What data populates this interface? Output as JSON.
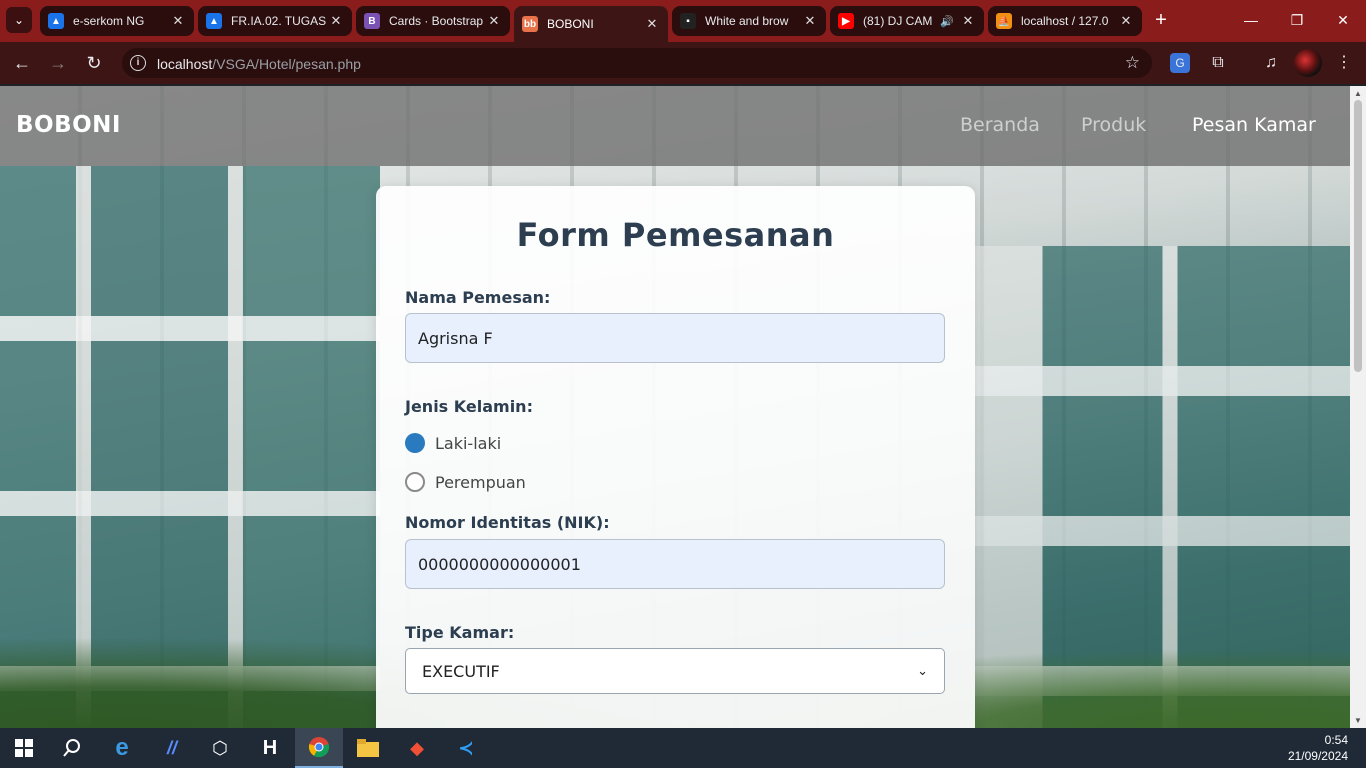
{
  "browser": {
    "tabs": [
      {
        "title": "e-serkom NG",
        "favicon": "triangle-icon",
        "color": "#1a73e8"
      },
      {
        "title": "FR.IA.02. TUGAS",
        "favicon": "triangle-icon",
        "color": "#1a73e8"
      },
      {
        "title": "Cards · Bootstrap",
        "favicon": "B",
        "color": "#7952b3"
      },
      {
        "title": "BOBONI",
        "favicon": "bb-icon",
        "color": "#e8734a"
      },
      {
        "title": "White and brow",
        "favicon": "image-icon",
        "color": "#222"
      },
      {
        "title": "(81) DJ CAM",
        "favicon": "youtube-icon",
        "color": "#ff0000"
      },
      {
        "title": "localhost / 127.0",
        "favicon": "pma-icon",
        "color": "#f29111"
      }
    ],
    "url_host": "localhost",
    "url_path": "/VSGA/Hotel/pesan.php"
  },
  "site": {
    "brand": "BOBONI",
    "nav": [
      "Beranda",
      "Produk",
      "Pesan Kamar"
    ]
  },
  "form": {
    "title": "Form Pemesanan",
    "name_label": "Nama Pemesan:",
    "name_value": "Agrisna F",
    "gender_label": "Jenis Kelamin:",
    "gender_options": [
      "Laki-laki",
      "Perempuan"
    ],
    "gender_selected": "Laki-laki",
    "nik_label": "Nomor Identitas (NIK):",
    "nik_value": "0000000000000001",
    "room_label": "Tipe Kamar:",
    "room_value": "EXECUTIF"
  },
  "taskbar": {
    "time": "0:54",
    "date": "21/09/2024"
  }
}
